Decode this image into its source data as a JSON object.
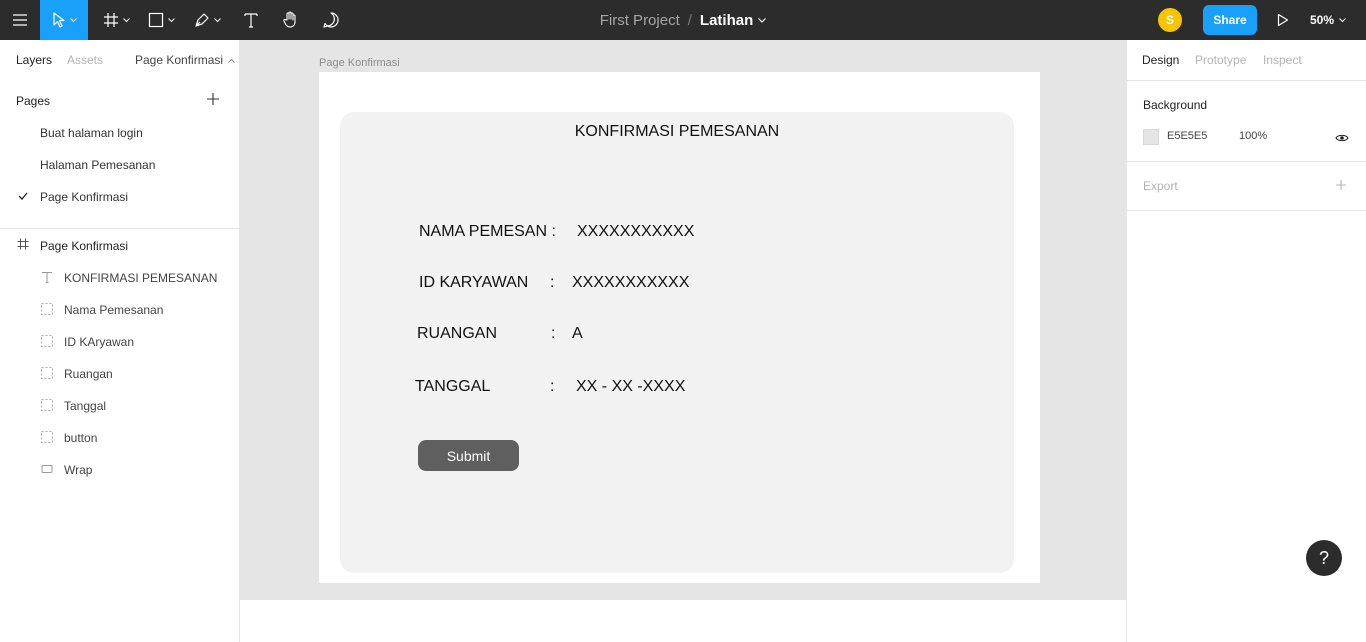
{
  "toolbar": {
    "project": "First Project",
    "separator": "/",
    "file": "Latihan",
    "avatar_initial": "S",
    "share_label": "Share",
    "zoom": "50%",
    "icons": [
      "menu-icon",
      "move-tool-icon",
      "frame-tool-icon",
      "shape-tool-icon",
      "pen-tool-icon",
      "text-tool-icon",
      "hand-tool-icon",
      "comment-tool-icon",
      "present-icon"
    ]
  },
  "left_panel": {
    "tabs": [
      "Layers",
      "Assets"
    ],
    "page_selector": "Page Konfirmasi",
    "pages_title": "Pages",
    "pages": [
      "Buat halaman login",
      "Halaman Pemesanan",
      "Page Konfirmasi"
    ],
    "active_page": "Page Konfirmasi",
    "frame_layer": "Page Konfirmasi",
    "layers": [
      {
        "name": "KONFIRMASI PEMESANAN",
        "icon": "text-layer-icon"
      },
      {
        "name": "Nama Pemesanan",
        "icon": "group-layer-icon"
      },
      {
        "name": "ID KAryawan",
        "icon": "group-layer-icon"
      },
      {
        "name": "Ruangan",
        "icon": "group-layer-icon"
      },
      {
        "name": "Tanggal",
        "icon": "group-layer-icon"
      },
      {
        "name": "button",
        "icon": "group-layer-icon"
      },
      {
        "name": "Wrap",
        "icon": "rectangle-layer-icon"
      }
    ]
  },
  "canvas": {
    "frame_label": "Page Konfirmasi",
    "design": {
      "title": "KONFIRMASI PEMESANAN",
      "nama_label": "NAMA PEMESAN :",
      "nama_value": "XXXXXXXXXXX",
      "id_label": "ID KARYAWAN",
      "id_colon": ":",
      "id_value": "XXXXXXXXXXX",
      "ruangan_label": "RUANGAN",
      "ruangan_colon": ":",
      "ruangan_value": "A",
      "tanggal_label": "TANGGAL",
      "tanggal_colon": ":",
      "tanggal_value": "XX - XX -XXXX",
      "submit_label": "Submit"
    }
  },
  "right_panel": {
    "tabs": [
      "Design",
      "Prototype",
      "Inspect"
    ],
    "background_title": "Background",
    "background_hex": "E5E5E5",
    "background_opacity": "100%",
    "export_title": "Export"
  },
  "help_label": "?",
  "colors": {
    "toolbar": "#2c2c2c",
    "accent": "#18a0fb",
    "avatar": "#f7c500",
    "canvas": "#e5e5e5",
    "wrap": "#f2f2f2",
    "button": "#5f5f5f"
  }
}
